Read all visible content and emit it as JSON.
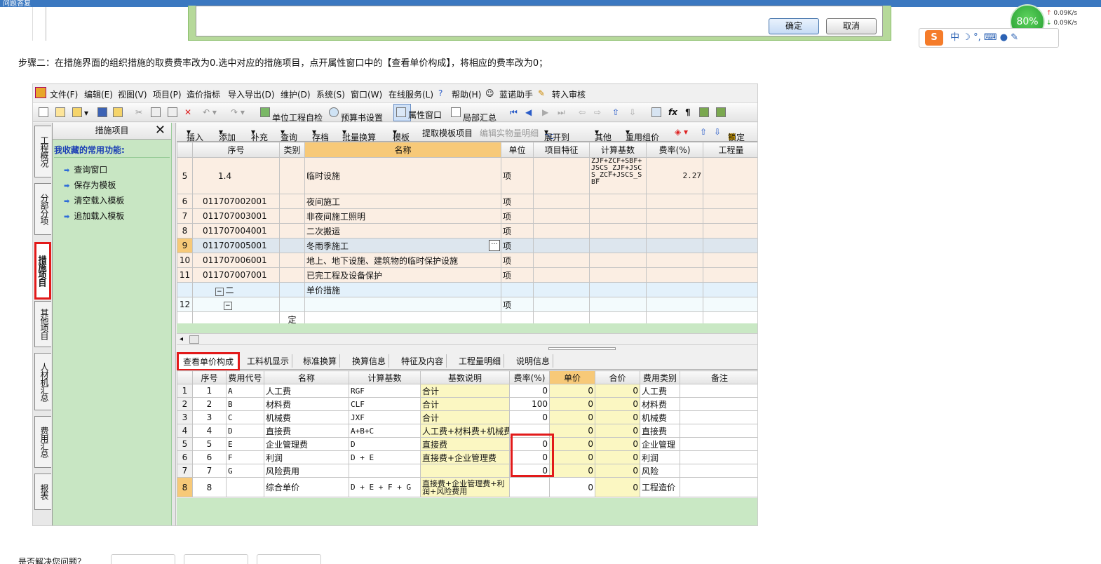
{
  "window": {
    "title": "问题答复"
  },
  "dialog": {
    "ok_label": "确定",
    "cancel_label": "取消"
  },
  "speed_widget": {
    "percent": "80%",
    "up": "0.09K/s",
    "down": "0.09K/s"
  },
  "ime_bar": {
    "mode": "中"
  },
  "caption": "步骤二：在措施界面的组织措施的取费费率改为0.选中对应的措施项目，点开属性窗口中的【查看单价构成】，将相应的费率改为0；",
  "menu": [
    "文件(F)",
    "编辑(E)",
    "视图(V)",
    "项目(P)",
    "造价指标",
    "导入导出(D)",
    "维护(D)",
    "系统(S)",
    "窗口(W)",
    "在线服务(L)",
    "帮助(H)",
    "蓝诺助手",
    "转入审核"
  ],
  "toolbar": {
    "self_check": "单位工程自检",
    "budget_settings": "预算书设置",
    "property_window": "属性窗口",
    "partial_sum": "局部汇总"
  },
  "vtabs": [
    "工程概况",
    "分部分项",
    "措施项目",
    "其他项目",
    "人材机汇总",
    "费用汇总",
    "报表"
  ],
  "left_panel": {
    "title": "措施项目",
    "favorites_title": "我收藏的常用功能:",
    "items": [
      "查询窗口",
      "保存为模板",
      "清空载入模板",
      "追加载入模板"
    ]
  },
  "toolbar2": [
    "插入",
    "添加",
    "补充",
    "查询",
    "存档",
    "批量换算",
    "模板",
    "提取模板项目",
    "编辑实物量明细",
    "展开到",
    "其他",
    "重用组价",
    "锁定"
  ],
  "grid": {
    "headers": [
      "序号",
      "类别",
      "名称",
      "单位",
      "项目特征",
      "计算基数",
      "费率(%)",
      "工程量"
    ],
    "rows": [
      {
        "rn": "5",
        "code": "1.4",
        "type": "",
        "name": "临时设施",
        "unit": "项",
        "base": "ZJF+ZCF+SBF+JSCS_ZJF+JSCS_ZCF+JSCS_SBF",
        "rate": "2.27"
      },
      {
        "rn": "6",
        "code": "011707002001",
        "type": "",
        "name": "夜间施工",
        "unit": "项",
        "base": "",
        "rate": ""
      },
      {
        "rn": "7",
        "code": "011707003001",
        "type": "",
        "name": "非夜间施工照明",
        "unit": "项",
        "base": "",
        "rate": ""
      },
      {
        "rn": "8",
        "code": "011707004001",
        "type": "",
        "name": "二次搬运",
        "unit": "项",
        "base": "",
        "rate": ""
      },
      {
        "rn": "9",
        "code": "011707005001",
        "type": "",
        "name": "冬雨季施工",
        "unit": "项",
        "base": "",
        "rate": ""
      },
      {
        "rn": "10",
        "code": "011707006001",
        "type": "",
        "name": "地上、地下设施、建筑物的临时保护设施",
        "unit": "项",
        "base": "",
        "rate": ""
      },
      {
        "rn": "11",
        "code": "011707007001",
        "type": "",
        "name": "已完工程及设备保护",
        "unit": "项",
        "base": "",
        "rate": ""
      },
      {
        "rn": "",
        "code": "二",
        "type": "",
        "name": "单价措施",
        "unit": "",
        "base": "",
        "rate": ""
      },
      {
        "rn": "12",
        "code": "",
        "type": "",
        "name": "",
        "unit": "项",
        "base": "",
        "rate": ""
      },
      {
        "rn": "",
        "code": "",
        "type": "定",
        "name": "",
        "unit": "",
        "base": "",
        "rate": ""
      }
    ]
  },
  "tabs2": [
    "查看单价构成",
    "工料机显示",
    "标准换算",
    "换算信息",
    "特征及内容",
    "工程量明细",
    "说明信息"
  ],
  "grid2": {
    "headers": [
      "序号",
      "费用代号",
      "名称",
      "计算基数",
      "基数说明",
      "费率(%)",
      "单价",
      "合价",
      "费用类别",
      "备注"
    ],
    "rows": [
      {
        "rn": "1",
        "no": "1",
        "code": "A",
        "name": "人工费",
        "base": "RGF",
        "desc": "合计",
        "rate": "0",
        "price": "0",
        "total": "0",
        "cat": "人工费"
      },
      {
        "rn": "2",
        "no": "2",
        "code": "B",
        "name": "材料费",
        "base": "CLF",
        "desc": "合计",
        "rate": "100",
        "price": "0",
        "total": "0",
        "cat": "材料费"
      },
      {
        "rn": "3",
        "no": "3",
        "code": "C",
        "name": "机械费",
        "base": "JXF",
        "desc": "合计",
        "rate": "0",
        "price": "0",
        "total": "0",
        "cat": "机械费"
      },
      {
        "rn": "4",
        "no": "4",
        "code": "D",
        "name": "直接费",
        "base": "A+B+C",
        "desc": "人工费+材料费+机械费",
        "rate": "",
        "price": "0",
        "total": "0",
        "cat": "直接费"
      },
      {
        "rn": "5",
        "no": "5",
        "code": "E",
        "name": "企业管理费",
        "base": "D",
        "desc": "直接费",
        "rate": "0",
        "price": "0",
        "total": "0",
        "cat": "企业管理"
      },
      {
        "rn": "6",
        "no": "6",
        "code": "F",
        "name": "利润",
        "base": "D + E",
        "desc": "直接费+企业管理费",
        "rate": "0",
        "price": "0",
        "total": "0",
        "cat": "利润"
      },
      {
        "rn": "7",
        "no": "7",
        "code": "G",
        "name": "风险费用",
        "base": "",
        "desc": "",
        "rate": "0",
        "price": "0",
        "total": "0",
        "cat": "风险"
      },
      {
        "rn": "8",
        "no": "8",
        "code": "",
        "name": "综合单价",
        "base": "D + E + F + G",
        "desc": "直接费+企业管理费+利润+风险费用",
        "rate": "",
        "price": "0",
        "total": "0",
        "cat": "工程造价"
      }
    ]
  },
  "footer": "是否解决您问题？"
}
